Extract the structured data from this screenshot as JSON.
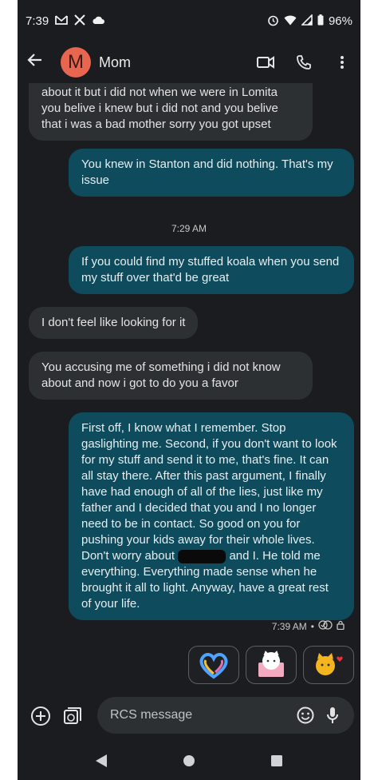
{
  "status_bar": {
    "time": "7:39",
    "battery": "96%",
    "icons": [
      "gmail-icon",
      "x-icon",
      "cloud-icon",
      "alarm-icon",
      "wifi-icon",
      "signal-icon",
      "battery-icon"
    ]
  },
  "header": {
    "avatar_initial": "M",
    "contact_name": "Mom",
    "avatar_color": "#e8654f"
  },
  "messages": [
    {
      "dir": "in",
      "text": "about it but i did not when we were in Lomita you belive i knew but i did not and you belive that i was a bad mother sorry you got upset"
    },
    {
      "dir": "out",
      "text": "You knew in Stanton and did nothing. That's my issue"
    },
    {
      "type": "timestamp",
      "text": "7:29 AM"
    },
    {
      "dir": "out",
      "text": "If you could find my stuffed koala when you send my stuff over that'd be great"
    },
    {
      "dir": "in",
      "text": "I don't feel like looking for it"
    },
    {
      "dir": "in",
      "text": "You accusing me of something i did not know about and now i got to do you a favor"
    },
    {
      "dir": "out",
      "text_before_redaction": "First off, I know what I remember. Stop gaslighting me. Second, if you don't want to look for my stuff and send it to me, that's fine. It can all stay there. After this past argument, I finally have had enough of all of the lies, just like my father and I decided that you and I no longer need to be in contact. So good on you for pushing your kids away for their whole lives. Don't worry about",
      "text_after_redaction": "and I. He told me everything. Everything made sense when he brought it all to light. Anyway, have a great rest of your life."
    }
  ],
  "delivery": {
    "time": "7:39 AM",
    "separator": "•"
  },
  "stickers": [
    "heart-sticker",
    "cat-card-sticker",
    "cat-heart-sticker"
  ],
  "composer": {
    "placeholder": "RCS message"
  },
  "colors": {
    "incoming_bubble": "#2d3033",
    "outgoing_bubble": "#0e4b5d",
    "background": "#1b1c1f"
  }
}
